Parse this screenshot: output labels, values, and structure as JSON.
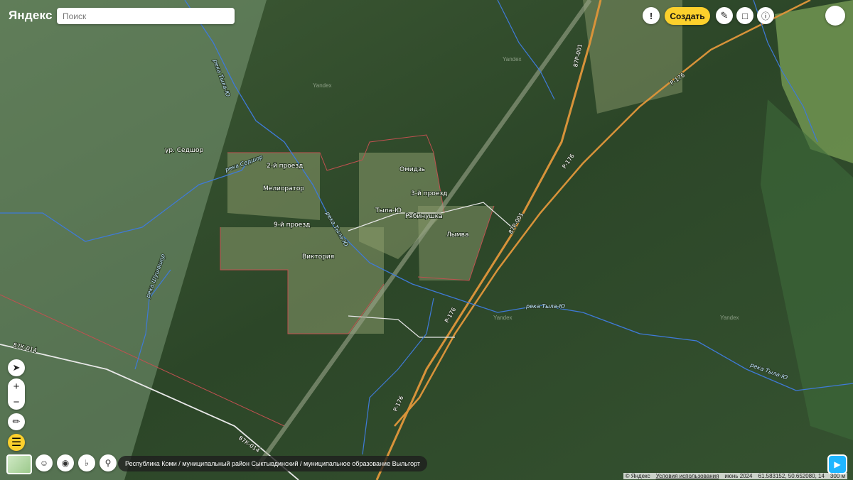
{
  "header": {
    "logo_text": "Яндекс",
    "search_placeholder": "Поиск",
    "create_label": "Создать"
  },
  "map_labels": {
    "settlements": [
      "Мелиоратор",
      "2-й проезд",
      "9-й проезд",
      "Тыла-Ю",
      "Рябинушка",
      "Омидзь",
      "Лымва",
      "Виктория",
      "3-й проезд",
      "ур. Седшор"
    ],
    "rivers": [
      "река Тыла-Ю",
      "река Седшор",
      "река Тыла-Ю",
      "река Тыла-Ю",
      "река Тыла-Ю",
      "река Шушашор"
    ],
    "roads": [
      "87Р-001",
      "87Р-001",
      "Р-176",
      "Р-176",
      "Р-176",
      "Р-176",
      "87К-014",
      "87К-014"
    ],
    "watermarks": [
      "Yandex",
      "Yandex",
      "Yandex",
      "Yandex"
    ]
  },
  "breadcrumb": "Республика Коми / муниципальный район Сыктывдинский / муниципальное образование Выльгорт",
  "status": {
    "copyright": "© Яндекс",
    "terms_link": "Условия использования",
    "imagery_date": "июнь 2024",
    "coordinates": "61.583152, 50.652080, 14",
    "scale": "300 м"
  },
  "icons": {
    "alert": "exclamation-icon",
    "ruler": "ruler-icon",
    "feedback": "chat-icon",
    "info": "info-icon",
    "locate": "navigation-arrow-icon",
    "measure": "measure-icon",
    "layers": "layers-icon",
    "panorama": "person-icon",
    "photo": "camera-icon",
    "transport": "transport-icon",
    "pin": "pin-icon"
  },
  "colors": {
    "road_major": "#d8933a",
    "river": "#3f7ad8",
    "boundary": "#c05050",
    "accent": "#fcd02c"
  }
}
